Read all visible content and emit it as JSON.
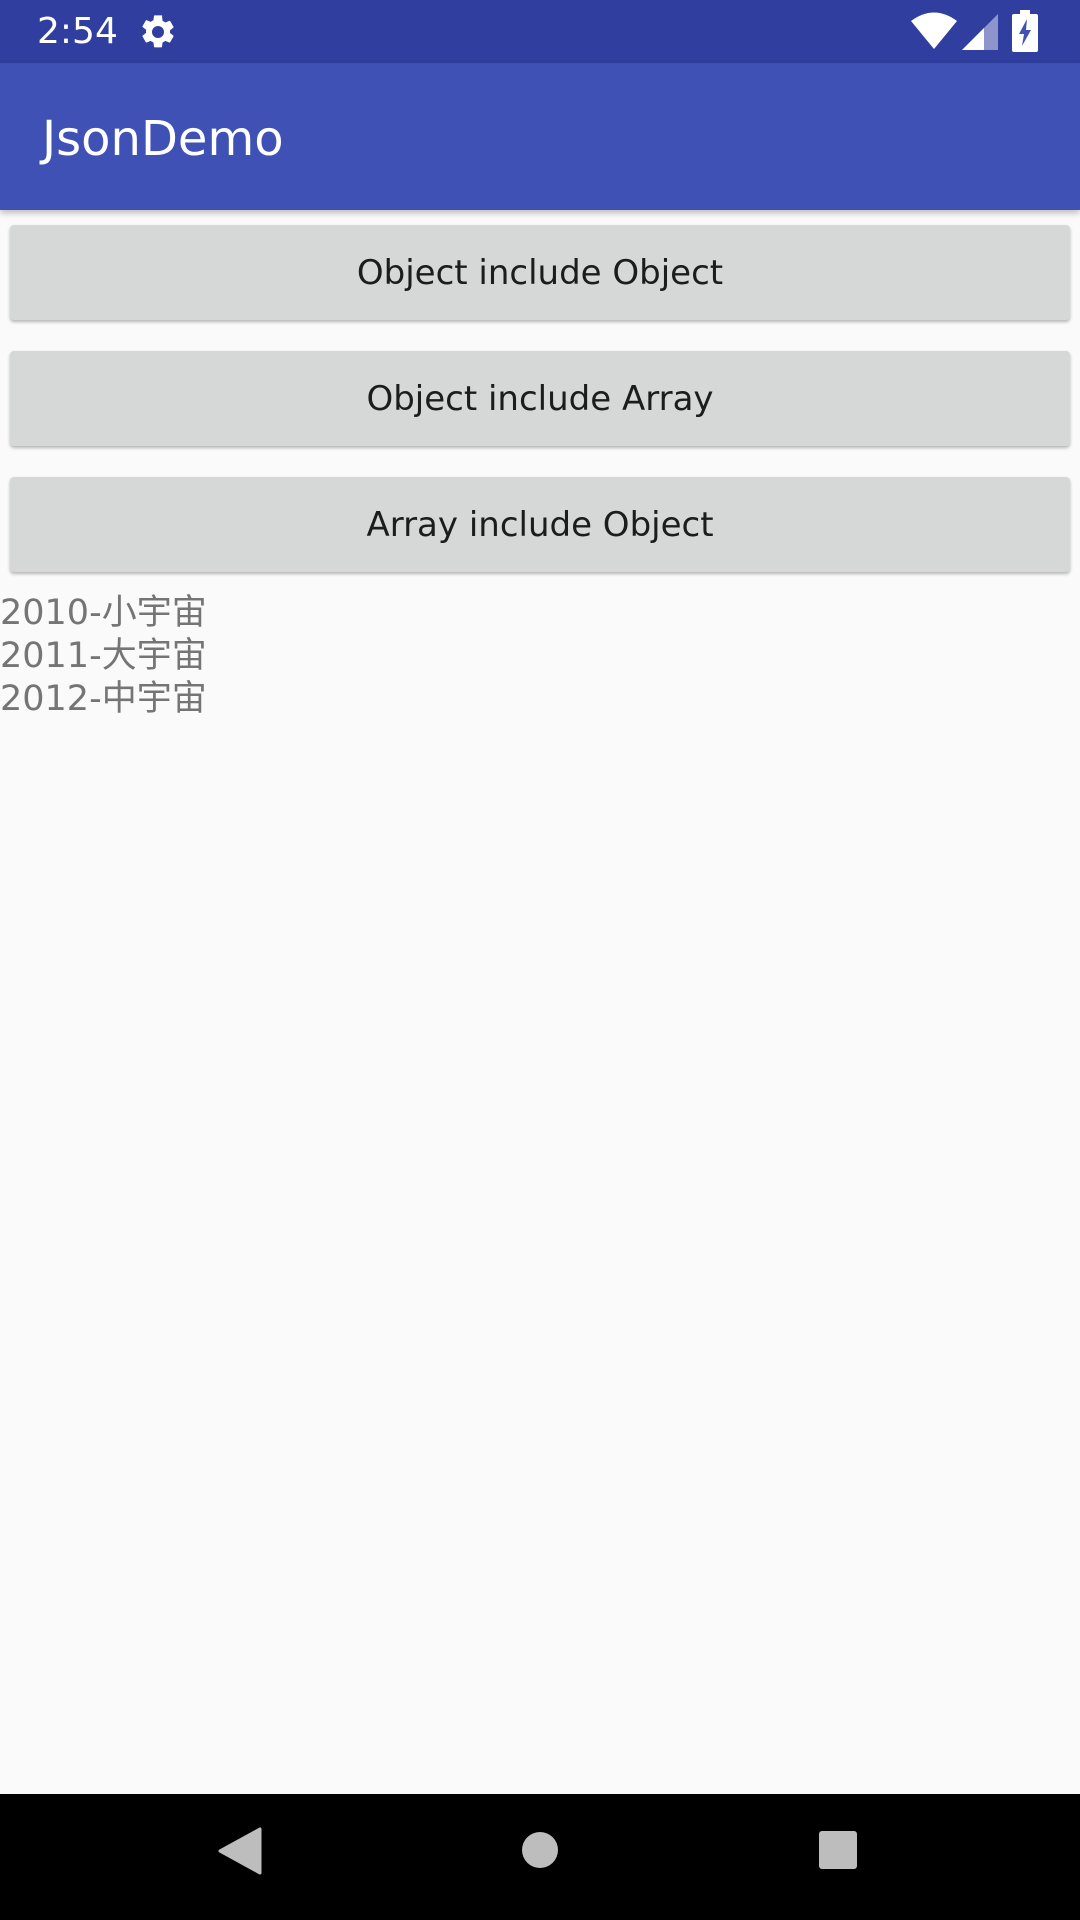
{
  "status_bar": {
    "time": "2:54",
    "icons": [
      "gear-icon",
      "wifi-icon",
      "signal-icon",
      "battery-charging-icon"
    ]
  },
  "app_bar": {
    "title": "JsonDemo"
  },
  "buttons": [
    {
      "label": "Object include Object"
    },
    {
      "label": "Object include Array"
    },
    {
      "label": "Array include Object"
    }
  ],
  "results": [
    "2010-小宇宙",
    "2011-大宇宙",
    "2012-中宇宙"
  ],
  "nav_bar": {
    "icons": [
      "back-icon",
      "home-icon",
      "recents-icon"
    ]
  },
  "colors": {
    "status_bar": "#303f9f",
    "app_bar": "#3f51b5",
    "background": "#fafafa",
    "button": "#d6d7d7",
    "result_text": "#757575"
  }
}
